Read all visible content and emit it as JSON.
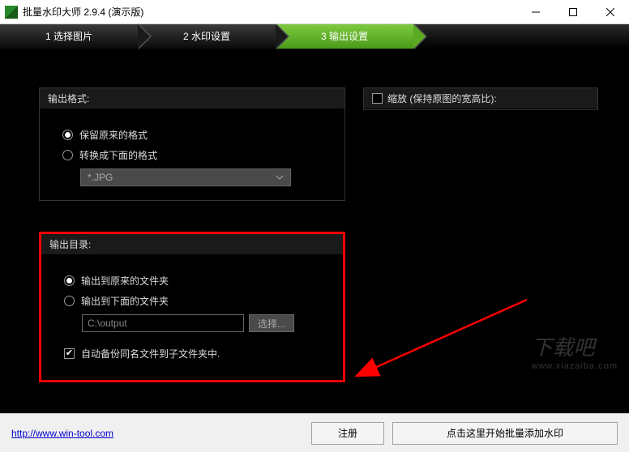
{
  "window": {
    "title": "批量水印大师 2.9.4 (演示版)"
  },
  "steps": {
    "s1": "1 选择图片",
    "s2": "2 水印设置",
    "s3": "3 输出设置"
  },
  "format_panel": {
    "header": "输出格式:",
    "keep_original": "保留原来的格式",
    "convert_to": "转换成下面的格式",
    "combo_value": "*.JPG"
  },
  "scale_panel": {
    "header": "缩放 (保持原图的宽高比):"
  },
  "output_panel": {
    "header": "输出目录:",
    "to_original": "输出到原来的文件夹",
    "to_below": "输出到下面的文件夹",
    "path_value": "C:\\output",
    "browse": "选择...",
    "backup_label": "自动备份同名文件到子文件夹中."
  },
  "footer": {
    "link": "http://www.win-tool.com",
    "register": "注册",
    "start": "点击这里开始批量添加水印"
  },
  "watermark": {
    "big": "下载吧",
    "small": "www.xiazaiba.com"
  }
}
